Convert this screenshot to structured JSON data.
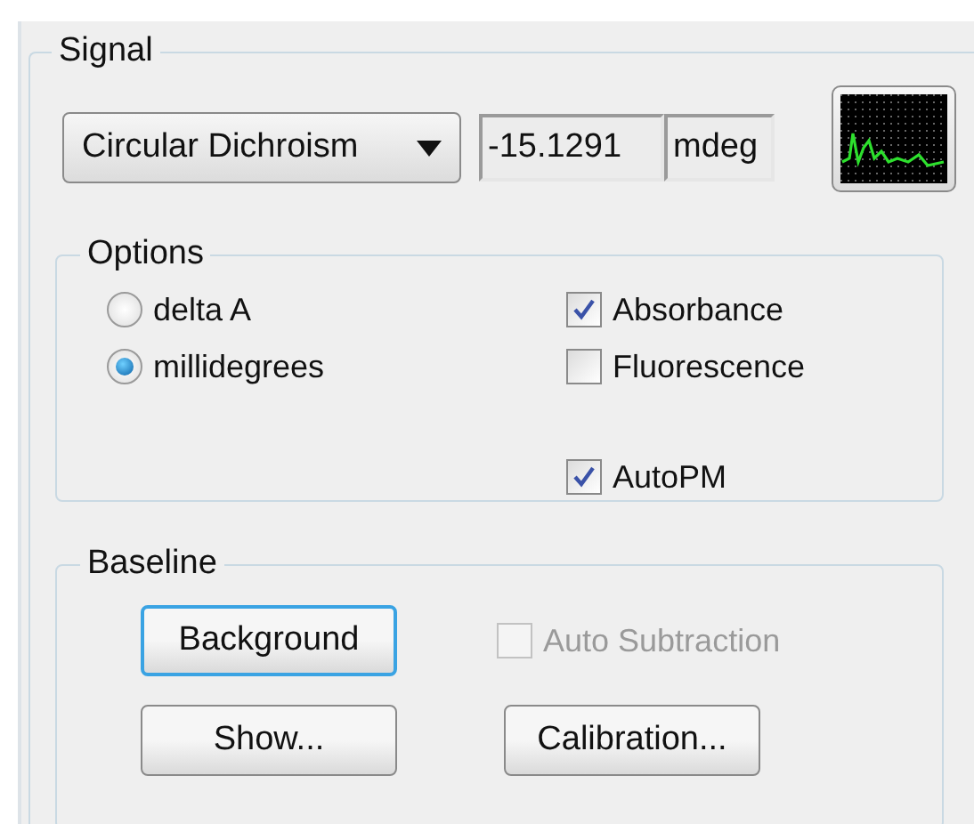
{
  "signal": {
    "title": "Signal",
    "mode": "Circular Dichroism",
    "value": "-15.1291",
    "unit": "mdeg"
  },
  "options": {
    "title": "Options",
    "radios": [
      {
        "label": "delta A",
        "selected": false
      },
      {
        "label": "millidegrees",
        "selected": true
      }
    ],
    "checkboxes": [
      {
        "label": "Absorbance",
        "checked": true
      },
      {
        "label": "Fluorescence",
        "checked": false
      },
      {
        "label": "AutoPM",
        "checked": true
      }
    ]
  },
  "baseline": {
    "title": "Baseline",
    "background_button": {
      "label": "Background",
      "focused": true
    },
    "auto_subtraction": {
      "label": "Auto Subtraction",
      "checked": false,
      "disabled": true
    },
    "show_button": {
      "label": "Show...",
      "focused": false
    },
    "calibration_button": {
      "label": "Calibration...",
      "focused": false
    }
  }
}
